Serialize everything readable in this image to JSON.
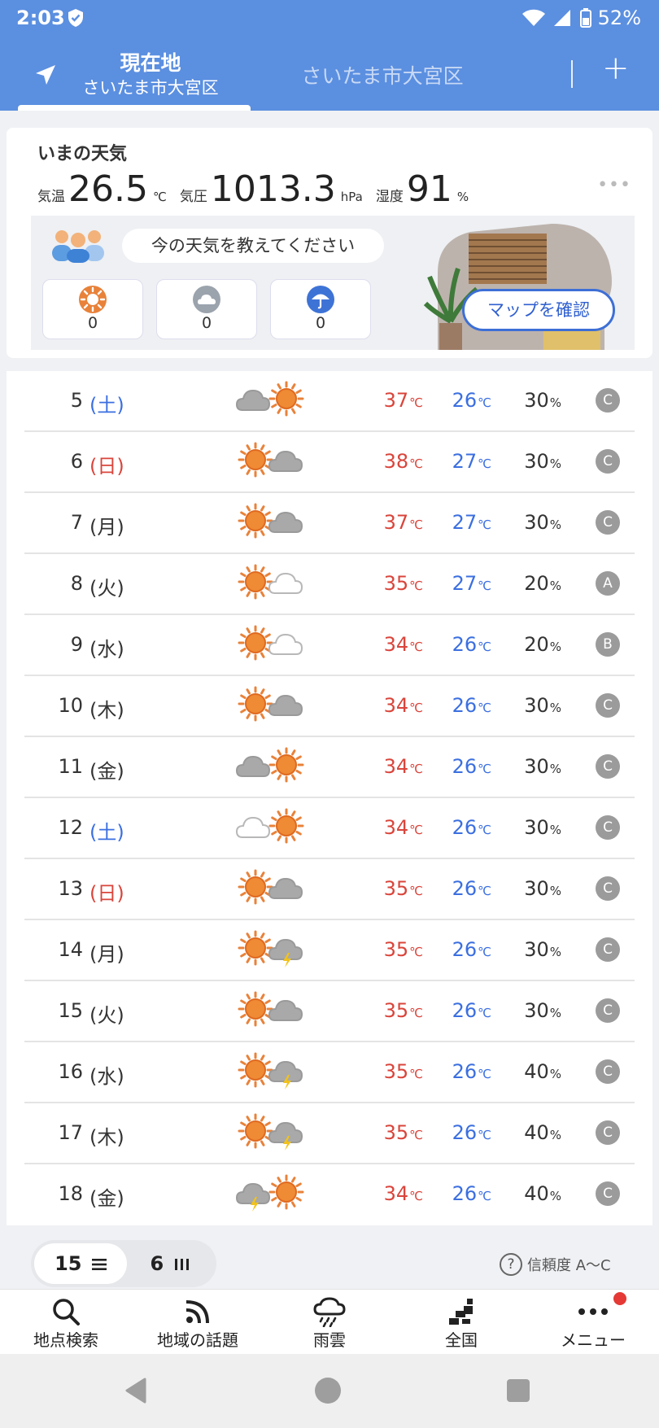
{
  "status_bar": {
    "time": "2:03",
    "battery": "52%"
  },
  "header": {
    "current_title": "現在地",
    "current_subtitle": "さいたま市大宮区",
    "second_tab": "さいたま市大宮区",
    "add_label": "+"
  },
  "now": {
    "title": "いまの天気",
    "temp_label": "気温",
    "temp_value": "26.5",
    "temp_unit": "℃",
    "pressure_label": "気圧",
    "pressure_value": "1013.3",
    "pressure_unit": "hPa",
    "humidity_label": "湿度",
    "humidity_value": "91",
    "humidity_unit": "%",
    "more": "•••",
    "prompt": "今の天気を教えてください",
    "votes": [
      {
        "icon": "sun-vote-icon",
        "count": "0"
      },
      {
        "icon": "cloud-vote-icon",
        "count": "0"
      },
      {
        "icon": "umbrella-vote-icon",
        "count": "0"
      }
    ],
    "map_button": "マップを確認"
  },
  "forecast": {
    "temp_unit": "℃",
    "pop_unit": "%",
    "rows": [
      {
        "day": "5",
        "weekday": "(土)",
        "kind": "sat",
        "icon": "cloud-sun",
        "hi": "37",
        "lo": "26",
        "pop": "30",
        "rel": "C"
      },
      {
        "day": "6",
        "weekday": "(日)",
        "kind": "sun",
        "icon": "sun-cloud",
        "hi": "38",
        "lo": "27",
        "pop": "30",
        "rel": "C"
      },
      {
        "day": "7",
        "weekday": "(月)",
        "kind": "wk",
        "icon": "sun-cloud",
        "hi": "37",
        "lo": "27",
        "pop": "30",
        "rel": "C"
      },
      {
        "day": "8",
        "weekday": "(火)",
        "kind": "wk",
        "icon": "sun-lightcloud",
        "hi": "35",
        "lo": "27",
        "pop": "20",
        "rel": "A"
      },
      {
        "day": "9",
        "weekday": "(水)",
        "kind": "wk",
        "icon": "sun-lightcloud",
        "hi": "34",
        "lo": "26",
        "pop": "20",
        "rel": "B"
      },
      {
        "day": "10",
        "weekday": "(木)",
        "kind": "wk",
        "icon": "sun-cloud",
        "hi": "34",
        "lo": "26",
        "pop": "30",
        "rel": "C"
      },
      {
        "day": "11",
        "weekday": "(金)",
        "kind": "wk",
        "icon": "cloud-sun",
        "hi": "34",
        "lo": "26",
        "pop": "30",
        "rel": "C"
      },
      {
        "day": "12",
        "weekday": "(土)",
        "kind": "sat",
        "icon": "lightcloud-sun",
        "hi": "34",
        "lo": "26",
        "pop": "30",
        "rel": "C"
      },
      {
        "day": "13",
        "weekday": "(日)",
        "kind": "sun",
        "icon": "sun-cloud",
        "hi": "35",
        "lo": "26",
        "pop": "30",
        "rel": "C"
      },
      {
        "day": "14",
        "weekday": "(月)",
        "kind": "wk",
        "icon": "sun-thunder",
        "hi": "35",
        "lo": "26",
        "pop": "30",
        "rel": "C"
      },
      {
        "day": "15",
        "weekday": "(火)",
        "kind": "wk",
        "icon": "sun-cloud",
        "hi": "35",
        "lo": "26",
        "pop": "30",
        "rel": "C"
      },
      {
        "day": "16",
        "weekday": "(水)",
        "kind": "wk",
        "icon": "sun-thunder",
        "hi": "35",
        "lo": "26",
        "pop": "40",
        "rel": "C"
      },
      {
        "day": "17",
        "weekday": "(木)",
        "kind": "wk",
        "icon": "sun-thunder",
        "hi": "35",
        "lo": "26",
        "pop": "40",
        "rel": "C"
      },
      {
        "day": "18",
        "weekday": "(金)",
        "kind": "wk",
        "icon": "thunder-sun",
        "hi": "34",
        "lo": "26",
        "pop": "40",
        "rel": "C"
      }
    ]
  },
  "toggle": {
    "list_label": "15",
    "chart_label": "6"
  },
  "reliability_label": "信頼度 A〜C",
  "bottom_nav": [
    {
      "label": "地点検索",
      "icon": "search-icon"
    },
    {
      "label": "地域の話題",
      "icon": "feed-icon"
    },
    {
      "label": "雨雲",
      "icon": "rain-cloud-icon"
    },
    {
      "label": "全国",
      "icon": "nationwide-icon"
    },
    {
      "label": "メニュー",
      "icon": "more-icon"
    }
  ]
}
